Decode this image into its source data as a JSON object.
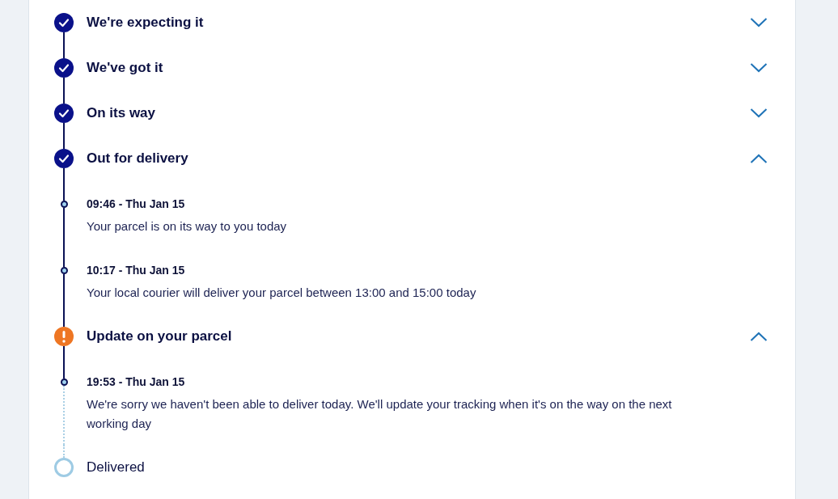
{
  "tracking_timeline": {
    "stages": [
      {
        "kind": "done",
        "title": "We're expecting it",
        "expanded": false
      },
      {
        "kind": "done",
        "title": "We've got it",
        "expanded": false
      },
      {
        "kind": "done",
        "title": "On its way",
        "expanded": false
      },
      {
        "kind": "done",
        "title": "Out for delivery",
        "expanded": true,
        "events": [
          {
            "time": "09:46 - Thu Jan 15",
            "message": "Your parcel is on its way to you today"
          },
          {
            "time": "10:17 - Thu Jan 15",
            "message": "Your local courier will deliver your parcel between 13:00 and 15:00 today"
          }
        ]
      },
      {
        "kind": "alert",
        "title": "Update on your parcel",
        "expanded": true,
        "events": [
          {
            "time": "19:53 - Thu Jan 15",
            "message": "We're sorry we haven't been able to deliver today. We'll update your tracking when it's on the way on the next working day"
          }
        ]
      },
      {
        "kind": "pending",
        "title": "Delivered"
      }
    ]
  }
}
